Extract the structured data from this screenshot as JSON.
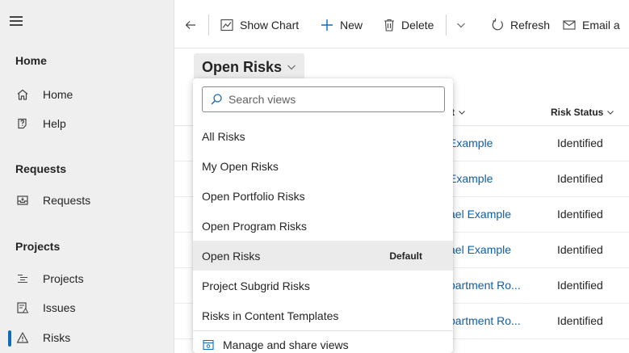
{
  "sidebar": {
    "sections": [
      {
        "title": "Home",
        "items": [
          {
            "label": "Home",
            "icon": "home-icon"
          },
          {
            "label": "Help",
            "icon": "help-icon"
          }
        ]
      },
      {
        "title": "Requests",
        "items": [
          {
            "label": "Requests",
            "icon": "inbox-icon"
          }
        ]
      },
      {
        "title": "Projects",
        "items": [
          {
            "label": "Projects",
            "icon": "task-list-icon"
          },
          {
            "label": "Issues",
            "icon": "issue-icon"
          },
          {
            "label": "Risks",
            "icon": "warning-icon",
            "active": true
          }
        ]
      }
    ]
  },
  "toolbar": {
    "show_chart": "Show Chart",
    "new": "New",
    "delete": "Delete",
    "refresh": "Refresh",
    "email": "Email a"
  },
  "view": {
    "title": "Open Risks"
  },
  "grid": {
    "headers": {
      "owner_partial": "t",
      "status": "Risk Status"
    },
    "rows": [
      {
        "owner": "Example",
        "status": "Identified"
      },
      {
        "owner": "Example",
        "status": "Identified"
      },
      {
        "owner": "ael Example",
        "status": "Identified"
      },
      {
        "owner": "ael Example",
        "status": "Identified"
      },
      {
        "owner": "partment Ro...",
        "status": "Identified"
      },
      {
        "owner": "partment Ro...",
        "status": "Identified"
      }
    ]
  },
  "view_selector": {
    "search_placeholder": "Search views",
    "items": [
      {
        "label": "All Risks"
      },
      {
        "label": "My Open Risks"
      },
      {
        "label": "Open Portfolio Risks"
      },
      {
        "label": "Open Program Risks"
      },
      {
        "label": "Open Risks",
        "badge": "Default",
        "selected": true
      },
      {
        "label": "Project Subgrid Risks"
      },
      {
        "label": "Risks in Content Templates"
      }
    ],
    "manage": "Manage and share views"
  },
  "colors": {
    "accent": "#0f6cbd",
    "link": "#115ea3",
    "sidebar_bg": "#efefef",
    "selected_bg": "#ebebeb"
  }
}
